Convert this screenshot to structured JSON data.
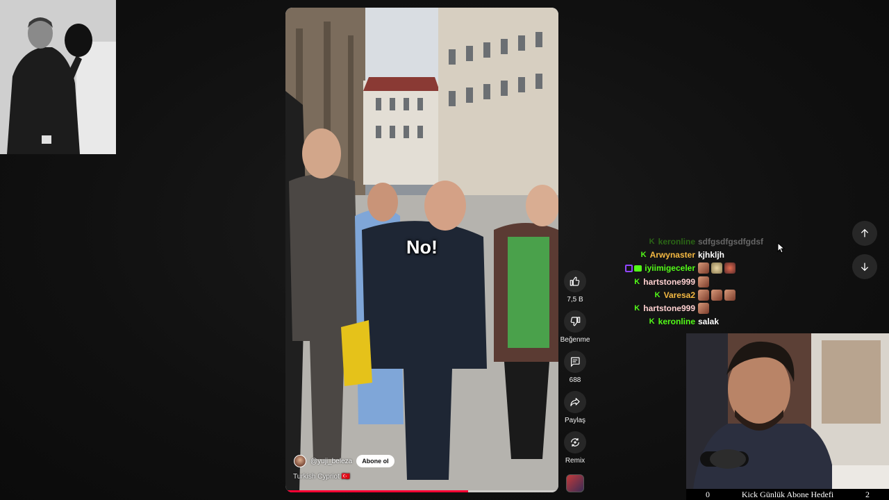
{
  "video": {
    "caption": "No!",
    "channel_name": "@yuji_beleza",
    "subscribe_label": "Abone ol",
    "title": "Turkish Cypriot 🇹🇷",
    "progress_percent": 67
  },
  "actions": {
    "like_count": "7,5 B",
    "dislike_label": "Beğenme",
    "comment_count": "688",
    "share_label": "Paylaş",
    "remix_label": "Remix"
  },
  "chat": {
    "messages": [
      {
        "username": "keronline",
        "user_color": "#53fc18",
        "message": "sdfgsdfgsdfgdsf",
        "badges": [
          "kick"
        ],
        "emotes": []
      },
      {
        "username": "Arwynaster",
        "user_color": "#f5b942",
        "message": "kjhkljh",
        "badges": [
          "kick"
        ],
        "emotes": []
      },
      {
        "username": "iyiimigeceler",
        "user_color": "#53fc18",
        "message": "",
        "badges": [
          "twitch",
          "sub"
        ],
        "emotes": [
          "face-emote",
          "egg-emote",
          "angry-emote"
        ]
      },
      {
        "username": "hartstone999",
        "user_color": "#ffd1d1",
        "message": "",
        "badges": [
          "kick"
        ],
        "emotes": [
          "face-emote"
        ]
      },
      {
        "username": "Varesa2",
        "user_color": "#f5b942",
        "message": "",
        "badges": [
          "kick"
        ],
        "emotes": [
          "face-emote",
          "face-emote",
          "face-emote"
        ]
      },
      {
        "username": "hartstone999",
        "user_color": "#ffd1d1",
        "message": "",
        "badges": [
          "kick"
        ],
        "emotes": [
          "face-emote"
        ]
      },
      {
        "username": "keronline",
        "user_color": "#53fc18",
        "message": "salak",
        "badges": [
          "kick"
        ],
        "emotes": []
      }
    ]
  },
  "goal": {
    "current": "0",
    "label": "Kick Günlük Abone Hedefi",
    "target": "2"
  },
  "colors": {
    "kick_green": "#53fc18",
    "youtube_red": "#ff0033",
    "action_button_bg": "#272727"
  }
}
